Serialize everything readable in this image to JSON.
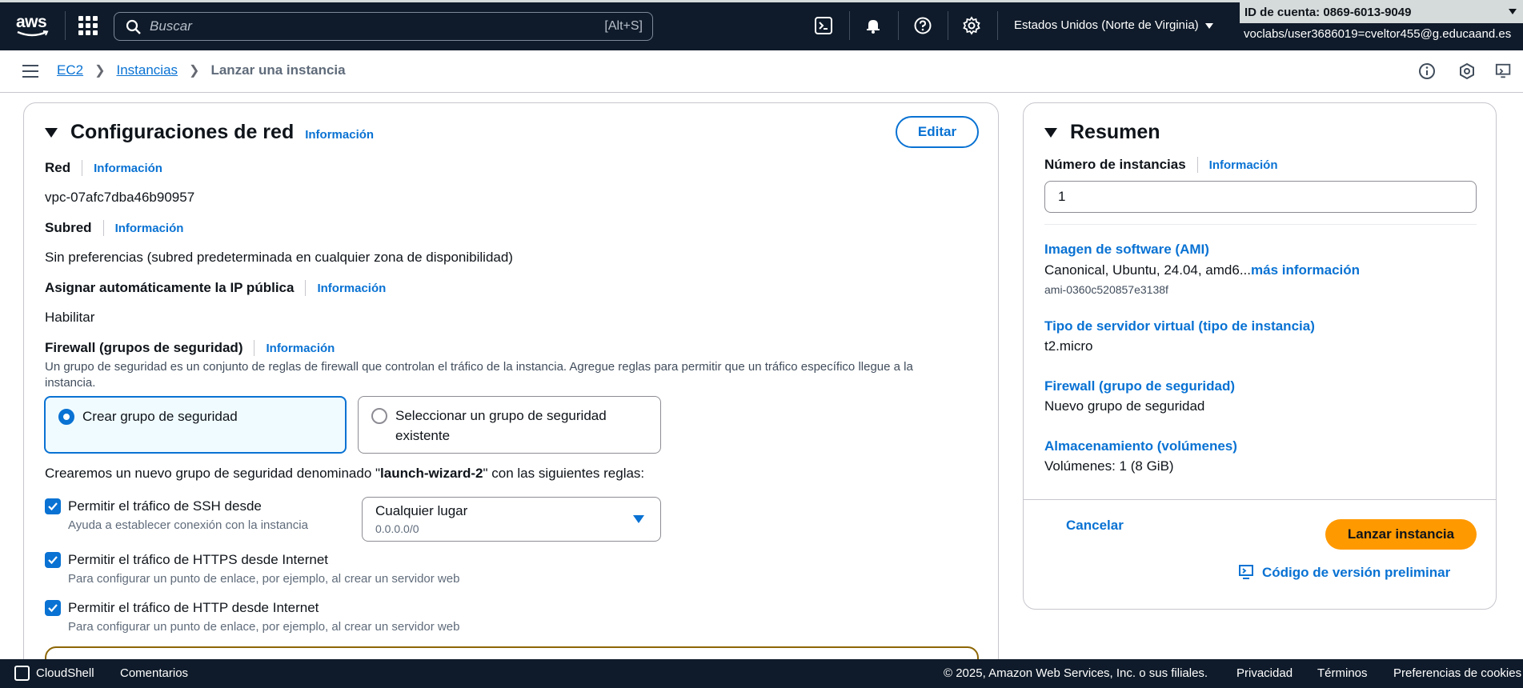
{
  "topnav": {
    "logo_text": "aws",
    "search_placeholder": "Buscar",
    "search_shortcut": "[Alt+S]",
    "region": "Estados Unidos (Norte de Virginia)",
    "account": "ID de cuenta: 0869-6013-9049",
    "user": "voclabs/user3686019=cveltor455@g.educaand.es"
  },
  "breadcrumb": {
    "items": [
      "EC2",
      "Instancias"
    ],
    "current": "Lanzar una instancia"
  },
  "network": {
    "title": "Configuraciones de red",
    "info": "Información",
    "edit": "Editar",
    "red_label": "Red",
    "red_value": "vpc-07afc7dba46b90957",
    "subred_label": "Subred",
    "subred_value": "Sin preferencias (subred predeterminada en cualquier zona de disponibilidad)",
    "ip_label": "Asignar automáticamente la IP pública",
    "ip_value": "Habilitar",
    "fw_label": "Firewall (grupos de seguridad)",
    "fw_help": "Un grupo de seguridad es un conjunto de reglas de firewall que controlan el tráfico de la instancia. Agregue reglas para permitir que un tráfico específico llegue a la instancia.",
    "radio_create": "Crear grupo de seguridad",
    "radio_select": "Seleccionar un grupo de seguridad existente",
    "create_text_prefix": "Crearemos un nuevo grupo de seguridad denominado \"",
    "group_name": "launch-wizard-2",
    "create_text_suffix": "\" con las siguientes reglas:",
    "ssh_label": "Permitir el tráfico de SSH desde",
    "ssh_sub": "Ayuda a establecer conexión con la instancia",
    "ssh_select_value": "Cualquier lugar",
    "ssh_select_sub": "0.0.0.0/0",
    "https_label": "Permitir el tráfico de HTTPS desde Internet",
    "https_sub": "Para configurar un punto de enlace, por ejemplo, al crear un servidor web",
    "http_label": "Permitir el tráfico de HTTP desde Internet",
    "http_sub": "Para configurar un punto de enlace, por ejemplo, al crear un servidor web"
  },
  "summary": {
    "title": "Resumen",
    "count_label": "Número de instancias",
    "info": "Información",
    "count_value": "1",
    "ami_label": "Imagen de software (AMI)",
    "ami_value": "Canonical, Ubuntu, 24.04, amd6...",
    "ami_more": "más información",
    "ami_id": "ami-0360c520857e3138f",
    "type_label": "Tipo de servidor virtual (tipo de instancia)",
    "type_value": "t2.micro",
    "fw_label": "Firewall (grupo de seguridad)",
    "fw_value": "Nuevo grupo de seguridad",
    "storage_label": "Almacenamiento (volúmenes)",
    "storage_value": "Volúmenes: 1 (8 GiB)",
    "cancel": "Cancelar",
    "launch": "Lanzar instancia",
    "code": "Código de versión preliminar"
  },
  "footer": {
    "cloudshell": "CloudShell",
    "feedback": "Comentarios",
    "copyright": "© 2025, Amazon Web Services, Inc. o sus filiales.",
    "privacy": "Privacidad",
    "terms": "Términos",
    "cookies": "Preferencias de cookies"
  },
  "colors": {
    "nav_bg": "#0f1b2a",
    "link": "#0972d3",
    "primary_button": "#ff9900"
  }
}
